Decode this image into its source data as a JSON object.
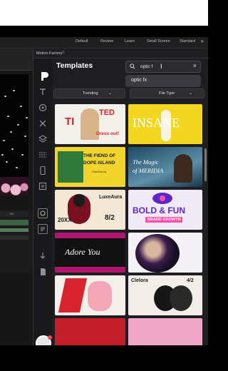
{
  "workspace_tabs": [
    "Default",
    "Review",
    "Learn",
    "Small Screen",
    "Standard"
  ],
  "workspace_more": "»",
  "timeline": {
    "ruler_label": "00;"
  },
  "panel": {
    "title": "Motion Factory",
    "menu_glyph": "≡"
  },
  "plugin": {
    "title": "Templates",
    "search": {
      "value": "optic f",
      "cursor": "I",
      "clear": "×"
    },
    "suggestion": "optic fx",
    "filters": {
      "trending": "Trending",
      "file_type": "File Type",
      "chevron": "⌄"
    }
  },
  "tiles": [
    {
      "name": "tile-timeless",
      "line1": "TI",
      "line2": "TED",
      "line3": "Dress out!"
    },
    {
      "name": "tile-insane",
      "line1": "INSANE"
    },
    {
      "name": "tile-fiend-of-dope-island",
      "line1": "THE FIEND OF",
      "line2": "DOPE ISLAND",
      "credit": "Directed by"
    },
    {
      "name": "tile-magic-of-meridia",
      "line1": "The Magic",
      "line2": "of MERIDIA"
    },
    {
      "name": "tile-luxeaura",
      "line1": "LuxeAura",
      "line2": "8/2",
      "line3": "20XX"
    },
    {
      "name": "tile-bold-and-fun",
      "line1": "BOLD & FUN",
      "line2": "BRAND GROWTH"
    },
    {
      "name": "tile-adore-you",
      "line1": "Adore You"
    },
    {
      "name": "tile-portrait-optic",
      "line1": ""
    },
    {
      "name": "tile-abstract-pink",
      "line1": ""
    },
    {
      "name": "tile-clelora",
      "line1": "Clelora",
      "line2": "4/2"
    }
  ],
  "colors": {
    "accent_yellow": "#f3d61f",
    "bold_purple": "#5a27c9",
    "bold_pink": "#ff4fa4"
  }
}
